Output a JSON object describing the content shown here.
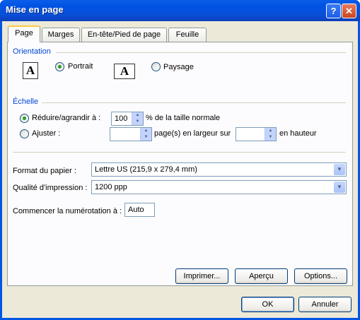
{
  "window": {
    "title": "Mise en page"
  },
  "titlebar": {
    "help": "?",
    "close": "✕"
  },
  "tabs": [
    {
      "label": "Page",
      "active": true
    },
    {
      "label": "Marges"
    },
    {
      "label": "En-tête/Pied de page"
    },
    {
      "label": "Feuille"
    }
  ],
  "orientation": {
    "group": "Orientation",
    "portrait": "Portrait",
    "paysage": "Paysage",
    "icon_glyph": "A",
    "selected": "portrait"
  },
  "echelle": {
    "group": "Échelle",
    "reduire_label": "Réduire/agrandir à :",
    "reduire_value": "100",
    "reduire_suffix": "% de la taille normale",
    "ajuster_label": "Ajuster :",
    "ajuster_width": "",
    "ajuster_mid": "page(s) en largeur sur",
    "ajuster_height": "",
    "ajuster_suffix": "en hauteur",
    "selected": "reduire"
  },
  "format": {
    "label": "Format du papier :",
    "value": "Lettre US (215,9 x 279,4 mm)"
  },
  "qualite": {
    "label": "Qualité d'impression :",
    "value": "1200 ppp"
  },
  "numerotation": {
    "label": "Commencer la numérotation à :",
    "value": "Auto"
  },
  "buttons": {
    "imprimer": "Imprimer...",
    "apercu": "Aperçu",
    "options": "Options...",
    "ok": "OK",
    "annuler": "Annuler"
  },
  "icons": {
    "spin_up": "▲",
    "spin_down": "▼",
    "combo_arrow": "▼"
  }
}
